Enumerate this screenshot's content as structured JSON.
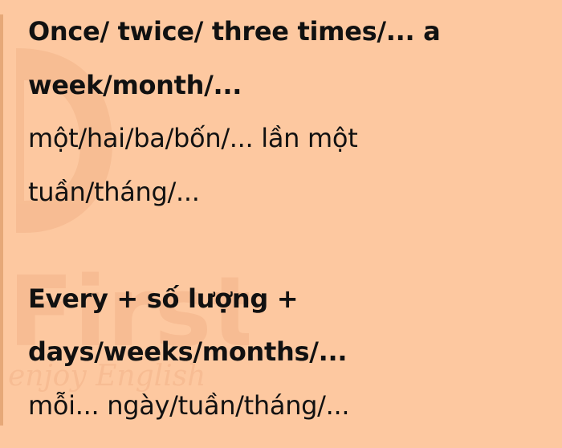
{
  "colors": {
    "background": "#fdc8a0",
    "text": "#111111",
    "left_rule": "#e6a878",
    "watermark": "#f0b58c"
  },
  "watermark": {
    "icon": "logo-watermark",
    "brand": "First",
    "tagline": "enjoy English"
  },
  "section1": {
    "heading_line1": "Once/ twice/ three times/... a",
    "heading_line2": "week/month/...",
    "body_line1": "một/hai/ba/bốn/... lần một",
    "body_line2": "tuần/tháng/..."
  },
  "section2": {
    "heading_line1": "Every + số lượng +",
    "heading_line2": "days/weeks/months/...",
    "body_line1": "mỗi... ngày/tuần/tháng/..."
  }
}
